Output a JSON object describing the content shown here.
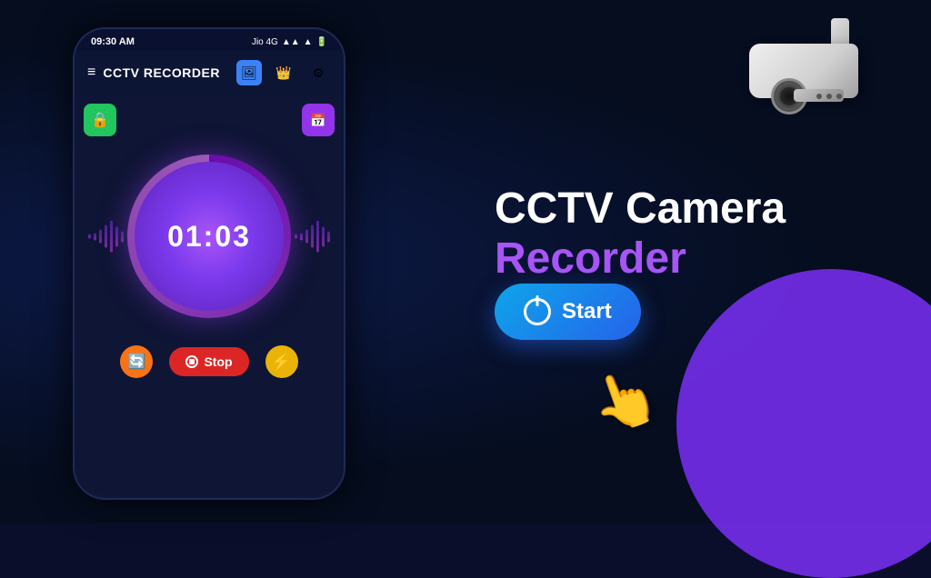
{
  "app": {
    "title": "CCTV RECORDER",
    "status_bar": {
      "time": "09:30 AM",
      "carrier": "Jio 4G"
    }
  },
  "timer": {
    "display": "01:03"
  },
  "controls": {
    "stop_label": "Stop"
  },
  "heading": {
    "line1": "CCTV Camera",
    "line2": "Recorder"
  },
  "start_button": {
    "label": "Start"
  },
  "icons": {
    "hamburger": "≡",
    "gallery": "🖼",
    "crown": "👑",
    "settings": "⚙",
    "camera_lock": "🔒",
    "schedule": "📅",
    "rotate": "🔄",
    "lightning": "⚡"
  }
}
